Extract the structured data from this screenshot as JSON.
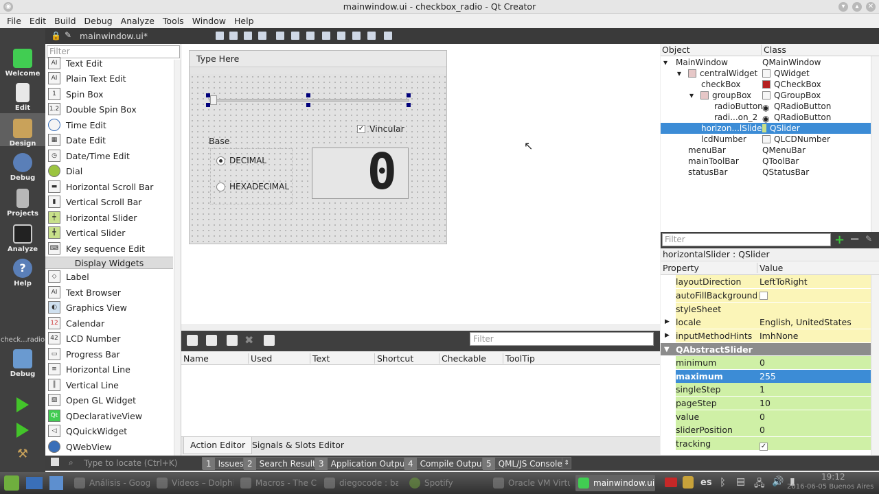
{
  "window": {
    "title": "mainwindow.ui - checkbox_radio - Qt Creator"
  },
  "menu": [
    "File",
    "Edit",
    "Build",
    "Debug",
    "Analyze",
    "Tools",
    "Window",
    "Help"
  ],
  "modes": [
    {
      "label": "Welcome",
      "icon": "qt-welcome-icon"
    },
    {
      "label": "Edit",
      "icon": "edit-icon"
    },
    {
      "label": "Design",
      "icon": "design-icon"
    },
    {
      "label": "Debug",
      "icon": "debug-icon"
    },
    {
      "label": "Projects",
      "icon": "projects-icon"
    },
    {
      "label": "Analyze",
      "icon": "analyze-icon"
    },
    {
      "label": "Help",
      "icon": "help-icon"
    }
  ],
  "kit": {
    "project": "check...radio",
    "label": "Debug"
  },
  "editor": {
    "file": "mainwindow.ui*"
  },
  "widgetbox": {
    "filter_placeholder": "Filter",
    "items_a": [
      "Text Edit",
      "Plain Text Edit",
      "Spin Box",
      "Double Spin Box",
      "Time Edit",
      "Date Edit",
      "Date/Time Edit",
      "Dial",
      "Horizontal Scroll Bar",
      "Vertical Scroll Bar",
      "Horizontal Slider",
      "Vertical Slider",
      "Key sequence Edit"
    ],
    "category": "Display Widgets",
    "items_b": [
      "Label",
      "Text Browser",
      "Graphics View",
      "Calendar",
      "LCD Number",
      "Progress Bar",
      "Horizontal Line",
      "Vertical Line",
      "Open GL Widget",
      "QDeclarativeView",
      "QQuickWidget",
      "QWebView"
    ]
  },
  "form": {
    "menu_placeholder": "Type Here",
    "checkbox": "Vincular",
    "checkbox_checked": true,
    "groupbox": "Base",
    "radio1": "DECIMAL",
    "radio2": "HEXADECIMAL",
    "lcd": "0"
  },
  "action_editor": {
    "filter_placeholder": "Filter",
    "columns": [
      "Name",
      "Used",
      "Text",
      "Shortcut",
      "Checkable",
      "ToolTip"
    ],
    "tabs": [
      "Action Editor",
      "Signals & Slots Editor"
    ]
  },
  "object_inspector": {
    "headers": [
      "Object",
      "Class"
    ],
    "rows": [
      {
        "name": "MainWindow",
        "cls": "QMainWindow"
      },
      {
        "name": "centralWidget",
        "cls": "QWidget"
      },
      {
        "name": "checkBox",
        "cls": "QCheckBox"
      },
      {
        "name": "groupBox",
        "cls": "QGroupBox"
      },
      {
        "name": "radioButton",
        "cls": "QRadioButton"
      },
      {
        "name": "radi...on_2",
        "cls": "QRadioButton"
      },
      {
        "name": "horizon...lSlider",
        "cls": "QSlider"
      },
      {
        "name": "lcdNumber",
        "cls": "QLCDNumber"
      },
      {
        "name": "menuBar",
        "cls": "QMenuBar"
      },
      {
        "name": "mainToolBar",
        "cls": "QToolBar"
      },
      {
        "name": "statusBar",
        "cls": "QStatusBar"
      }
    ]
  },
  "property_editor": {
    "filter_placeholder": "Filter",
    "title": "horizontalSlider : QSlider",
    "headers": [
      "Property",
      "Value"
    ],
    "rows": [
      {
        "name": "layoutDirection",
        "value": "LeftToRight"
      },
      {
        "name": "autoFillBackground",
        "value": ""
      },
      {
        "name": "styleSheet",
        "value": ""
      },
      {
        "name": "locale",
        "value": "English, UnitedStates"
      },
      {
        "name": "inputMethodHints",
        "value": "ImhNone"
      },
      {
        "name": "QAbstractSlider",
        "value": ""
      },
      {
        "name": "minimum",
        "value": "0"
      },
      {
        "name": "maximum",
        "value": "255"
      },
      {
        "name": "singleStep",
        "value": "1"
      },
      {
        "name": "pageStep",
        "value": "10"
      },
      {
        "name": "value",
        "value": "0"
      },
      {
        "name": "sliderPosition",
        "value": "0"
      },
      {
        "name": "tracking",
        "value": ""
      }
    ]
  },
  "output": {
    "locate_placeholder": "Type to locate (Ctrl+K)",
    "panes": [
      {
        "n": "1",
        "label": "Issues"
      },
      {
        "n": "2",
        "label": "Search Results"
      },
      {
        "n": "3",
        "label": "Application Output"
      },
      {
        "n": "4",
        "label": "Compile Output"
      },
      {
        "n": "5",
        "label": "QML/JS Console"
      }
    ]
  },
  "taskbar": {
    "tasks": [
      "Análisis - Googl",
      "Videos – Dolphin",
      "Macros - The C P",
      "diegocode : bas",
      "Spotify",
      "Oracle VM Virtu",
      "mainwindow.ui"
    ],
    "lang": "es",
    "time": "19:12",
    "date": "2016-06-05 Buenos Aires"
  }
}
